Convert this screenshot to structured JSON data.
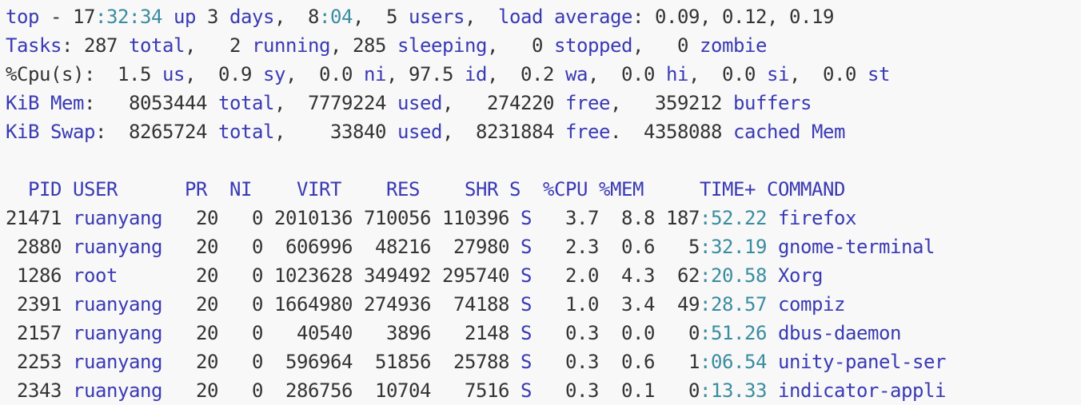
{
  "colors": {
    "background": "#f8f8f8",
    "plain_text": "#333333",
    "keyword_blue": "#3a3ab4",
    "time_teal": "#3a8ca0"
  },
  "summary": [
    [
      {
        "t": "top",
        "c": "k"
      },
      {
        "t": " - 17",
        "c": "p"
      },
      {
        "t": ":32:34",
        "c": "t"
      },
      {
        "t": " ",
        "c": "p"
      },
      {
        "t": "up",
        "c": "k"
      },
      {
        "t": " 3 ",
        "c": "p"
      },
      {
        "t": "days",
        "c": "k"
      },
      {
        "t": ",  8",
        "c": "p"
      },
      {
        "t": ":04",
        "c": "t"
      },
      {
        "t": ",  5 ",
        "c": "p"
      },
      {
        "t": "users",
        "c": "k"
      },
      {
        "t": ",  ",
        "c": "p"
      },
      {
        "t": "load average",
        "c": "k"
      },
      {
        "t": ": 0.09, 0.12, 0.19",
        "c": "p"
      }
    ],
    [
      {
        "t": "Tasks",
        "c": "k"
      },
      {
        "t": ": 287 ",
        "c": "p"
      },
      {
        "t": "total",
        "c": "k"
      },
      {
        "t": ",   2 ",
        "c": "p"
      },
      {
        "t": "running",
        "c": "k"
      },
      {
        "t": ", 285 ",
        "c": "p"
      },
      {
        "t": "sleeping",
        "c": "k"
      },
      {
        "t": ",   0 ",
        "c": "p"
      },
      {
        "t": "stopped",
        "c": "k"
      },
      {
        "t": ",   0 ",
        "c": "p"
      },
      {
        "t": "zombie",
        "c": "k"
      }
    ],
    [
      {
        "t": "%Cpu(s)",
        "c": "p"
      },
      {
        "t": ":  1.5 ",
        "c": "p"
      },
      {
        "t": "us",
        "c": "k"
      },
      {
        "t": ",  0.9 ",
        "c": "p"
      },
      {
        "t": "sy",
        "c": "k"
      },
      {
        "t": ",  0.0 ",
        "c": "p"
      },
      {
        "t": "ni",
        "c": "k"
      },
      {
        "t": ", 97.5 ",
        "c": "p"
      },
      {
        "t": "id",
        "c": "k"
      },
      {
        "t": ",  0.2 ",
        "c": "p"
      },
      {
        "t": "wa",
        "c": "k"
      },
      {
        "t": ",  0.0 ",
        "c": "p"
      },
      {
        "t": "hi",
        "c": "k"
      },
      {
        "t": ",  0.0 ",
        "c": "p"
      },
      {
        "t": "si",
        "c": "k"
      },
      {
        "t": ",  0.0 ",
        "c": "p"
      },
      {
        "t": "st",
        "c": "k"
      }
    ],
    [
      {
        "t": "KiB Mem",
        "c": "k"
      },
      {
        "t": ":   8053444 ",
        "c": "p"
      },
      {
        "t": "total",
        "c": "k"
      },
      {
        "t": ",  7779224 ",
        "c": "p"
      },
      {
        "t": "used",
        "c": "k"
      },
      {
        "t": ",   274220 ",
        "c": "p"
      },
      {
        "t": "free",
        "c": "k"
      },
      {
        "t": ",   359212 ",
        "c": "p"
      },
      {
        "t": "buffers",
        "c": "k"
      }
    ],
    [
      {
        "t": "KiB Swap",
        "c": "k"
      },
      {
        "t": ":  8265724 ",
        "c": "p"
      },
      {
        "t": "total",
        "c": "k"
      },
      {
        "t": ",    33840 ",
        "c": "p"
      },
      {
        "t": "used",
        "c": "k"
      },
      {
        "t": ",  8231884 ",
        "c": "p"
      },
      {
        "t": "free",
        "c": "k"
      },
      {
        "t": ".  4358088 ",
        "c": "p"
      },
      {
        "t": "cached Mem",
        "c": "k"
      }
    ]
  ],
  "process_table": {
    "header": "  PID USER      PR  NI    VIRT    RES    SHR S  %CPU %MEM     TIME+ COMMAND",
    "rows": [
      {
        "pid": "21471",
        "user": "ruanyang",
        "pr": "20",
        "ni": "0",
        "virt": "2010136",
        "res": "710056",
        "shr": "110396",
        "s": "S",
        "cpu": "3.7",
        "mem": "8.8",
        "time_a": "187",
        "time_b": ":52.22",
        "command": "firefox"
      },
      {
        "pid": "2880",
        "user": "ruanyang",
        "pr": "20",
        "ni": "0",
        "virt": "606996",
        "res": "48216",
        "shr": "27980",
        "s": "S",
        "cpu": "2.3",
        "mem": "0.6",
        "time_a": "5",
        "time_b": ":32.19",
        "command": "gnome-terminal"
      },
      {
        "pid": "1286",
        "user": "root",
        "pr": "20",
        "ni": "0",
        "virt": "1023628",
        "res": "349492",
        "shr": "295740",
        "s": "S",
        "cpu": "2.0",
        "mem": "4.3",
        "time_a": "62",
        "time_b": ":20.58",
        "command": "Xorg"
      },
      {
        "pid": "2391",
        "user": "ruanyang",
        "pr": "20",
        "ni": "0",
        "virt": "1664980",
        "res": "274936",
        "shr": "74188",
        "s": "S",
        "cpu": "1.0",
        "mem": "3.4",
        "time_a": "49",
        "time_b": ":28.57",
        "command": "compiz"
      },
      {
        "pid": "2157",
        "user": "ruanyang",
        "pr": "20",
        "ni": "0",
        "virt": "40540",
        "res": "3896",
        "shr": "2148",
        "s": "S",
        "cpu": "0.3",
        "mem": "0.0",
        "time_a": "0",
        "time_b": ":51.26",
        "command": "dbus-daemon"
      },
      {
        "pid": "2253",
        "user": "ruanyang",
        "pr": "20",
        "ni": "0",
        "virt": "596964",
        "res": "51856",
        "shr": "25788",
        "s": "S",
        "cpu": "0.3",
        "mem": "0.6",
        "time_a": "1",
        "time_b": ":06.54",
        "command": "unity-panel-ser"
      },
      {
        "pid": "2343",
        "user": "ruanyang",
        "pr": "20",
        "ni": "0",
        "virt": "286756",
        "res": "10704",
        "shr": "7516",
        "s": "S",
        "cpu": "0.3",
        "mem": "0.1",
        "time_a": "0",
        "time_b": ":13.33",
        "command": "indicator-appli"
      }
    ]
  }
}
